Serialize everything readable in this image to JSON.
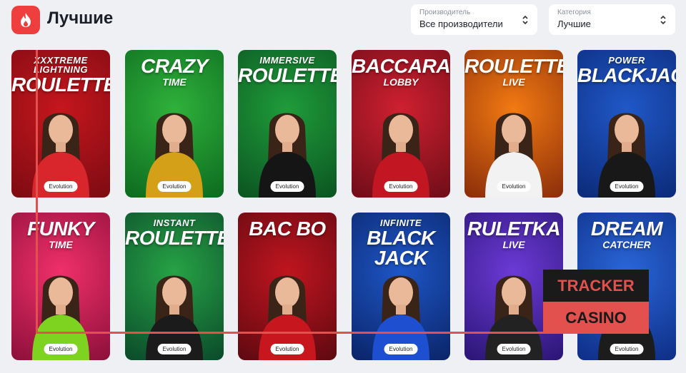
{
  "header": {
    "title": "Лучшие",
    "icon": "flame-icon",
    "provider_select": {
      "label": "Производитель",
      "value": "Все производители"
    },
    "category_select": {
      "label": "Категория",
      "value": "Лучшие"
    }
  },
  "games": [
    {
      "small": "XXXTREME LIGHTNING",
      "big": "ROULETTE",
      "sub": "",
      "provider": "Evolution",
      "bg1": "#c5161d",
      "bg2": "#7d0b12",
      "dress": "#d8262c"
    },
    {
      "small": "",
      "big": "CRAZY",
      "sub": "TIME",
      "provider": "Evolution",
      "bg1": "#2fb13b",
      "bg2": "#0d6a1f",
      "dress": "#d4a017"
    },
    {
      "small": "IMMERSIVE",
      "big": "ROULETTE",
      "sub": "",
      "provider": "Evolution",
      "bg1": "#1f9c3a",
      "bg2": "#0b5421",
      "dress": "#151515"
    },
    {
      "small": "",
      "big": "BACCARAT",
      "sub": "LOBBY",
      "provider": "Evolution",
      "bg1": "#cf2030",
      "bg2": "#6e0d18",
      "dress": "#c21622"
    },
    {
      "small": "",
      "big": "ROULETTE",
      "sub": "LIVE",
      "provider": "Evolution",
      "bg1": "#f27a12",
      "bg2": "#8a2d0a",
      "dress": "#f2f2f2"
    },
    {
      "small": "POWER",
      "big": "BLACKJACK",
      "sub": "",
      "provider": "Evolution",
      "bg1": "#2058c8",
      "bg2": "#0b2a78",
      "dress": "#181818"
    },
    {
      "small": "",
      "big": "FUNKY",
      "sub": "TIME",
      "provider": "Evolution",
      "bg1": "#f0306a",
      "bg2": "#8c0f3a",
      "dress": "#7ed321"
    },
    {
      "small": "INSTANT",
      "big": "ROULETTE",
      "sub": "",
      "provider": "Evolution",
      "bg1": "#27a346",
      "bg2": "#0a4a2a",
      "dress": "#1b1b1b"
    },
    {
      "small": "",
      "big": "BAC BO",
      "sub": "",
      "provider": "Evolution",
      "bg1": "#c0151f",
      "bg2": "#5e0910",
      "dress": "#c8161e"
    },
    {
      "small": "INFINITE",
      "big": "BLACK JACK",
      "sub": "",
      "provider": "Evolution",
      "bg1": "#1e56c6",
      "bg2": "#0a2468",
      "dress": "#1e4fd0"
    },
    {
      "small": "",
      "big": "RULETKA",
      "sub": "LIVE",
      "provider": "Evolution",
      "bg1": "#6c3ad6",
      "bg2": "#2a1574",
      "dress": "#222"
    },
    {
      "small": "",
      "big": "DREAM",
      "sub": "CATCHER",
      "provider": "Evolution",
      "bg1": "#2a66d8",
      "bg2": "#0d2e86",
      "dress": "#1c1c1c"
    }
  ],
  "watermark": {
    "line1": "TRACKER",
    "line2": "CASINO",
    "accent": "#e2514e",
    "dark": "#1a1a1a"
  }
}
